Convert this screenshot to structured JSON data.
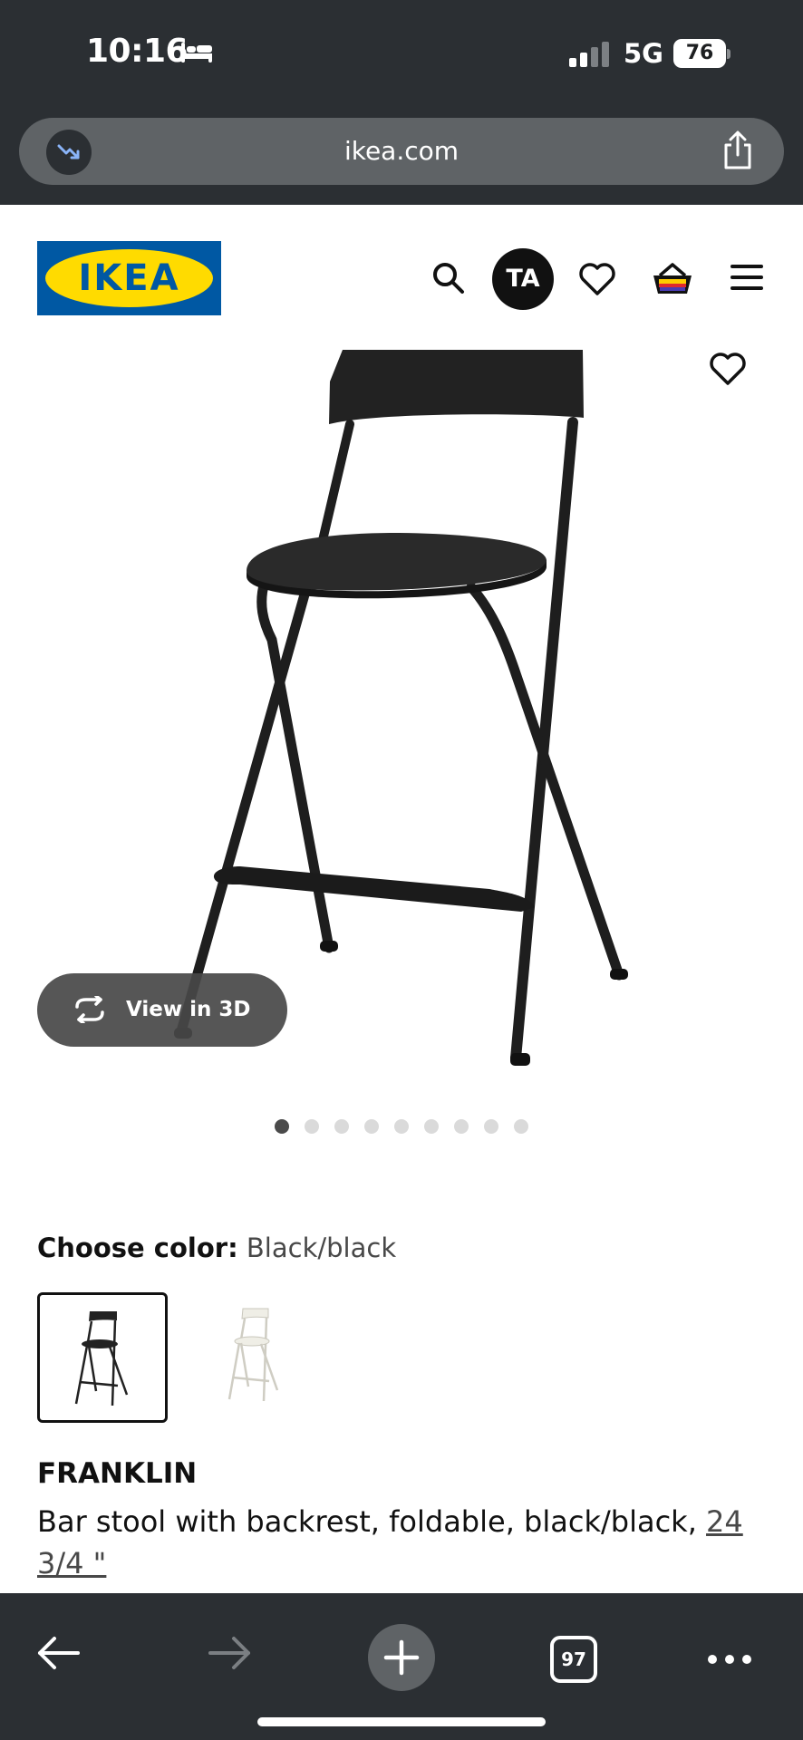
{
  "status": {
    "time": "10:16",
    "network": "5G",
    "battery": "76"
  },
  "browser": {
    "url": "ikea.com"
  },
  "header": {
    "avatar_initials": "TA"
  },
  "product": {
    "view3d_label": "View in 3D",
    "image_count": 9,
    "active_image_index": 0,
    "color_prefix": "Choose color:",
    "color_value": "Black/black",
    "swatches": [
      "black",
      "white"
    ],
    "name": "FRANKLIN",
    "description": "Bar stool with backrest, foldable, black/black,",
    "size": "24 3/4 \""
  },
  "toolbar": {
    "tab_count": "97"
  },
  "colors": {
    "chrome": "#2b2f33",
    "pill": "#5f6366",
    "ikea_blue": "#0058a3",
    "ikea_yellow": "#ffdb00"
  }
}
